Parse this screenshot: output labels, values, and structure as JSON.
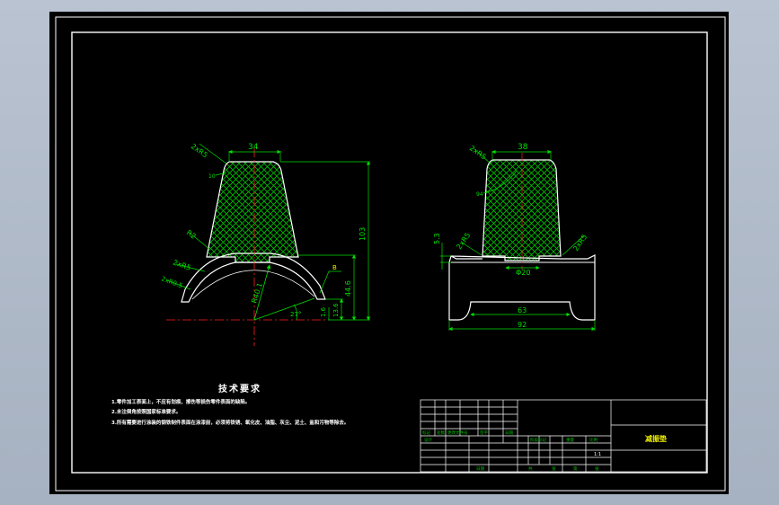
{
  "colors": {
    "canvas": "#000000",
    "frame": "#ffffff",
    "dim": "#00e000",
    "hatch": "#00c000",
    "centerline": "#ff2020",
    "note_text": "#ffffff",
    "title_text": "#f0f000",
    "table_label": "#00c000"
  },
  "front_view": {
    "dim_top_width": "34",
    "dim_corner_radius": "2xR5",
    "dim_small_10": "10",
    "dim_fillet_r2": "R2",
    "dim_r5_lower": "2xR5",
    "dim_r0_5": "2xR0.5",
    "dim_radius_40": "R40.1",
    "dim_angle": "27°",
    "dim_height_103": "103",
    "dim_height_44_6": "44.6",
    "dim_height_13_6": "13.6",
    "dim_height_1_6": "1.6",
    "callout_tag": "B"
  },
  "side_view": {
    "dim_top_width": "38",
    "dim_corner_radius": "2xR5",
    "dim_small_94": "94",
    "dim_height_5_3": "5.3",
    "dim_left_r5": "2xR5",
    "dim_right_r5": "2xR5",
    "dim_hole": "Φ20",
    "dim_inner_width": "63",
    "dim_overall_width": "92"
  },
  "notes": {
    "title": "技术要求",
    "items": [
      "1.零件加工表面上，不应有划痕、擦伤等损伤零件表面的缺陷。",
      "2.未注倒角按照国家标准要求。",
      "3.所有需要进行涂装的钢铁制件表面在涂漆前，必须将铁锈、氧化皮、油脂、灰尘、泥土、盐和污物等除去。"
    ]
  },
  "title_block": {
    "part_name": "减振垫",
    "scale": "1:1",
    "labels": {
      "mark": "标记",
      "count": "处数",
      "change_doc": "更改文件号",
      "signature": "签字",
      "date": "日期",
      "design": "设计",
      "stage_mark": "阶段标记",
      "weight": "重量",
      "ratio": "比例",
      "sheet_total": "共",
      "sheet_no": "第",
      "page": "张"
    }
  }
}
